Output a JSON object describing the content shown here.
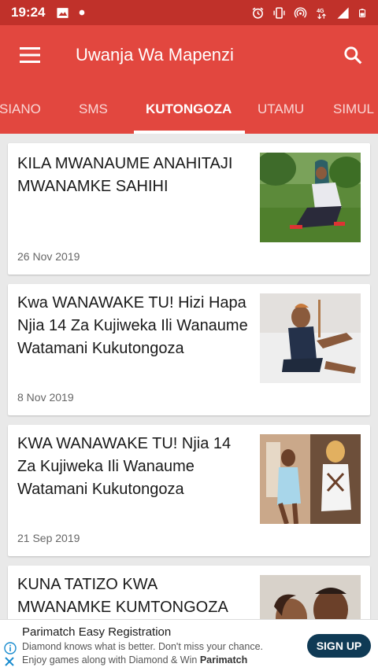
{
  "status_bar": {
    "time": "19:24",
    "left_icons": [
      "image-icon",
      "dot-icon"
    ],
    "right_icons": [
      "alarm-icon",
      "vibrate-icon",
      "hotspot-icon",
      "data-4g-icon",
      "signal-icon",
      "battery-icon"
    ]
  },
  "app_bar": {
    "title": "Uwanja Wa Mapenzi",
    "menu_icon": "hamburger-menu-icon",
    "search_icon": "search-icon"
  },
  "tabs": [
    {
      "label": "SIANO",
      "active": false
    },
    {
      "label": "SMS",
      "active": false
    },
    {
      "label": "KUTONGOZA",
      "active": true
    },
    {
      "label": "UTAMU",
      "active": false
    },
    {
      "label": "SIMUL",
      "active": false
    }
  ],
  "articles": [
    {
      "title": "KILA MWANAUME ANAHITAJI MWANAMKE SAHIHI",
      "date": "26 Nov 2019"
    },
    {
      "title": "Kwa WANAWAKE TU! Hizi Hapa Njia 14 Za Kujiweka Ili Wanaume Watamani Kukutongoza",
      "date": "8 Nov 2019"
    },
    {
      "title": "KWA WANAWAKE TU! Njia 14 Za Kujiweka Ili Wanaume Watamani Kukutongoza",
      "date": "21 Sep 2019"
    },
    {
      "title": "KUNA TATIZO KWA MWANAMKE KUMTONGOZA",
      "date": ""
    }
  ],
  "ad": {
    "title": "Parimatch Easy Registration",
    "line1": "Diamond knows what is better. Don't miss your chance.",
    "line2_prefix": "Enjoy games along with Diamond & Win ",
    "line2_brand": "Parimatch",
    "button": "SIGN UP"
  },
  "colors": {
    "status_bar": "#c0312a",
    "app_bar": "#e2473f",
    "ad_button": "#0f3a55",
    "background": "#e9e9e9"
  }
}
